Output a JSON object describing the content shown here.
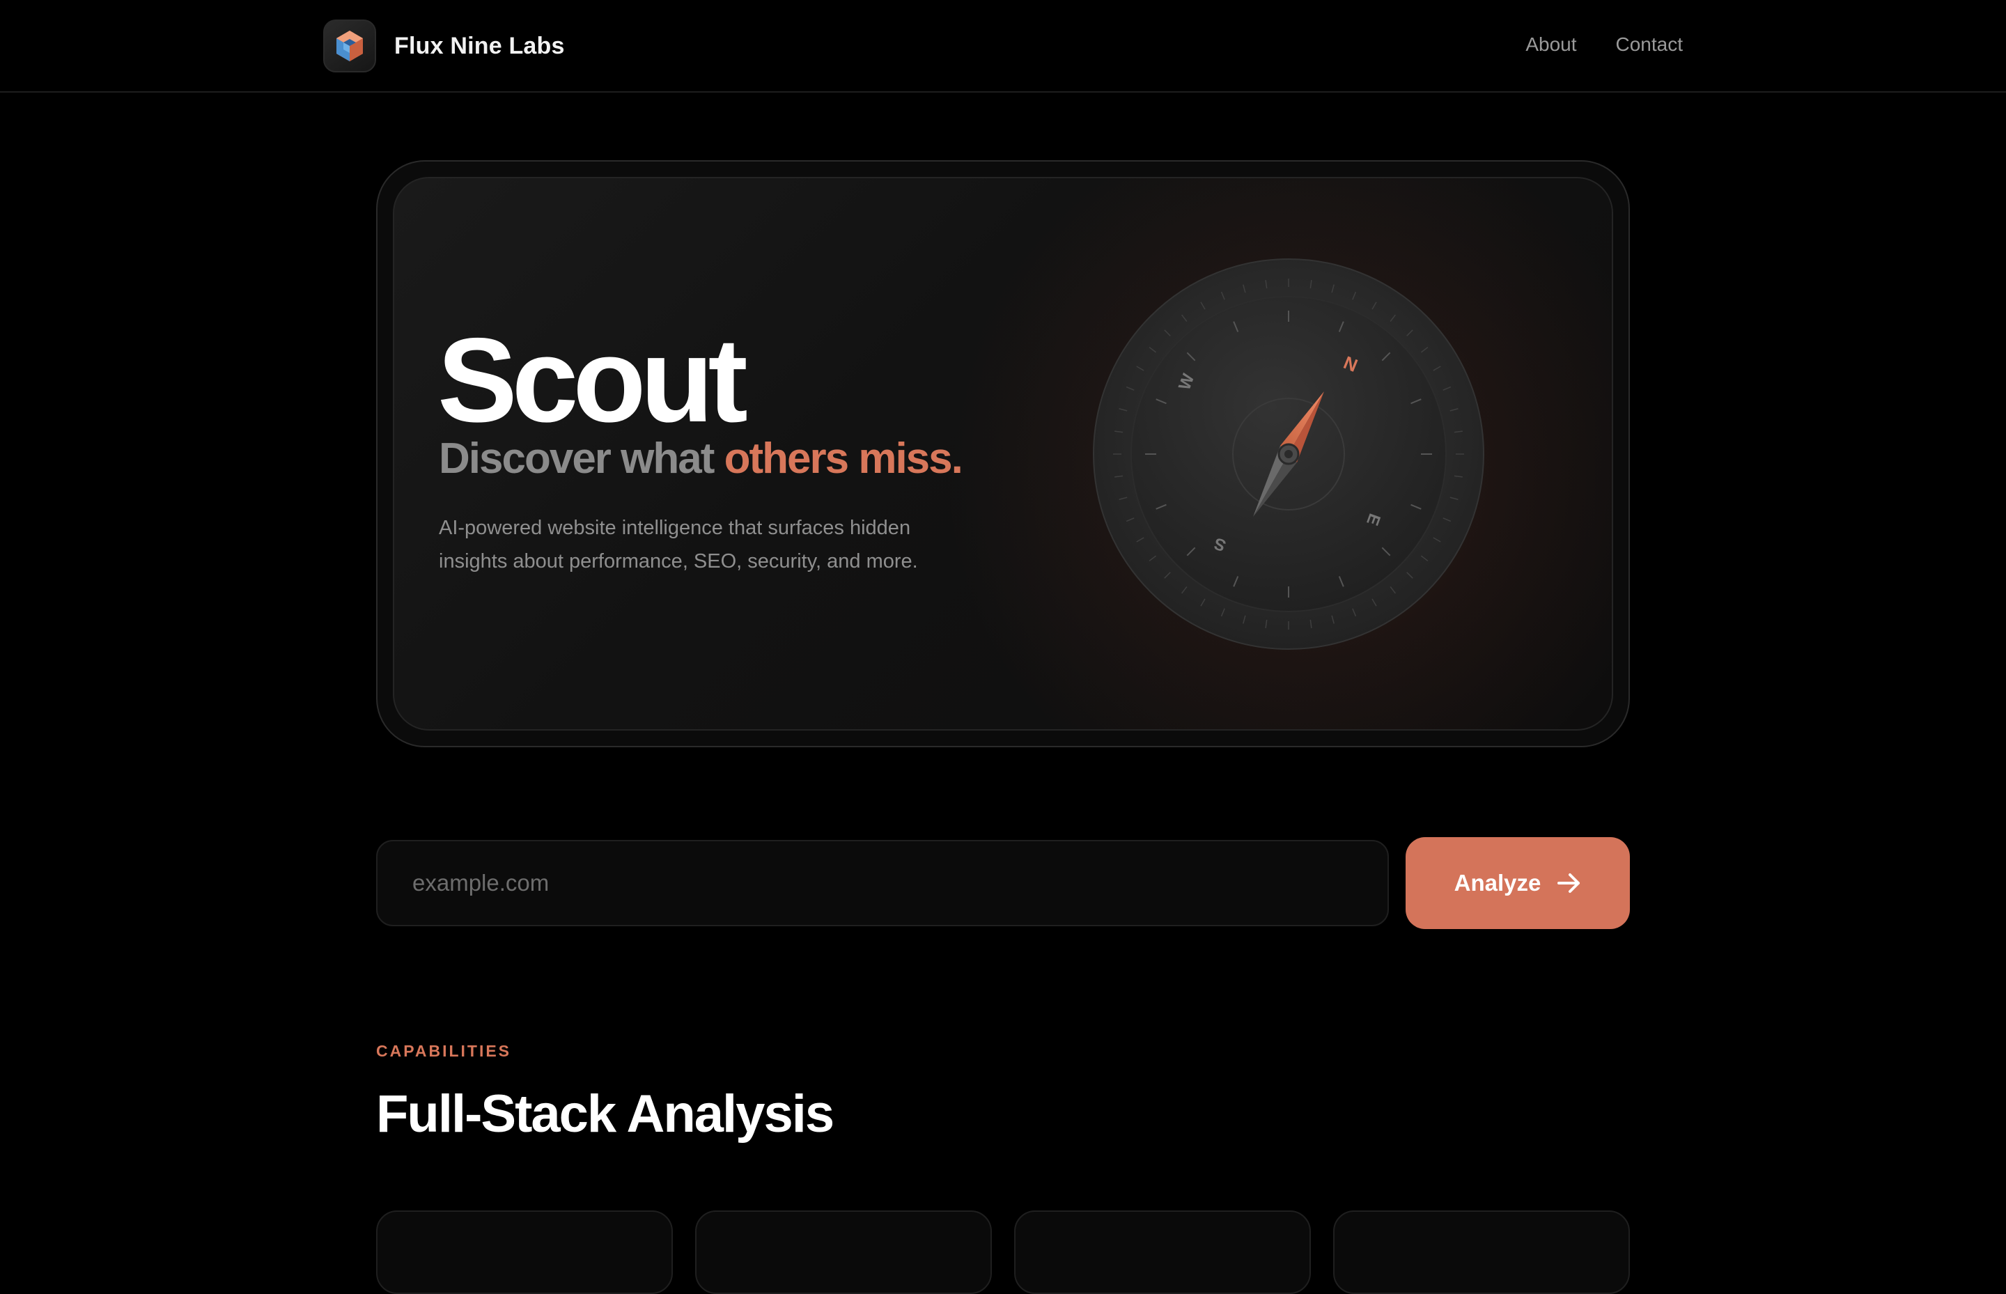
{
  "nav": {
    "brand_name": "Flux Nine Labs",
    "logo_icon": "hexagon-cube-logo-icon",
    "links": [
      "About",
      "Contact"
    ]
  },
  "hero": {
    "title": "Scout",
    "subtitle_lead": "Discover what ",
    "subtitle_accent": "others miss.",
    "description": "AI-powered website intelligence that surfaces hidden insights about performance, SEO, security, and more.",
    "illustration_icon": "compass-icon",
    "compass_labels": {
      "n": "N",
      "e": "E",
      "s": "S",
      "w": "W"
    }
  },
  "search": {
    "placeholder": "example.com",
    "value": "",
    "button_label": "Analyze",
    "button_icon": "arrow-right-icon"
  },
  "capabilities": {
    "eyebrow": "CAPABILITIES",
    "title": "Full-Stack Analysis",
    "cards": [
      {},
      {},
      {},
      {}
    ]
  },
  "colors": {
    "background": "#000000",
    "accent": "#d4745a",
    "muted_text": "#8f8f8f"
  }
}
